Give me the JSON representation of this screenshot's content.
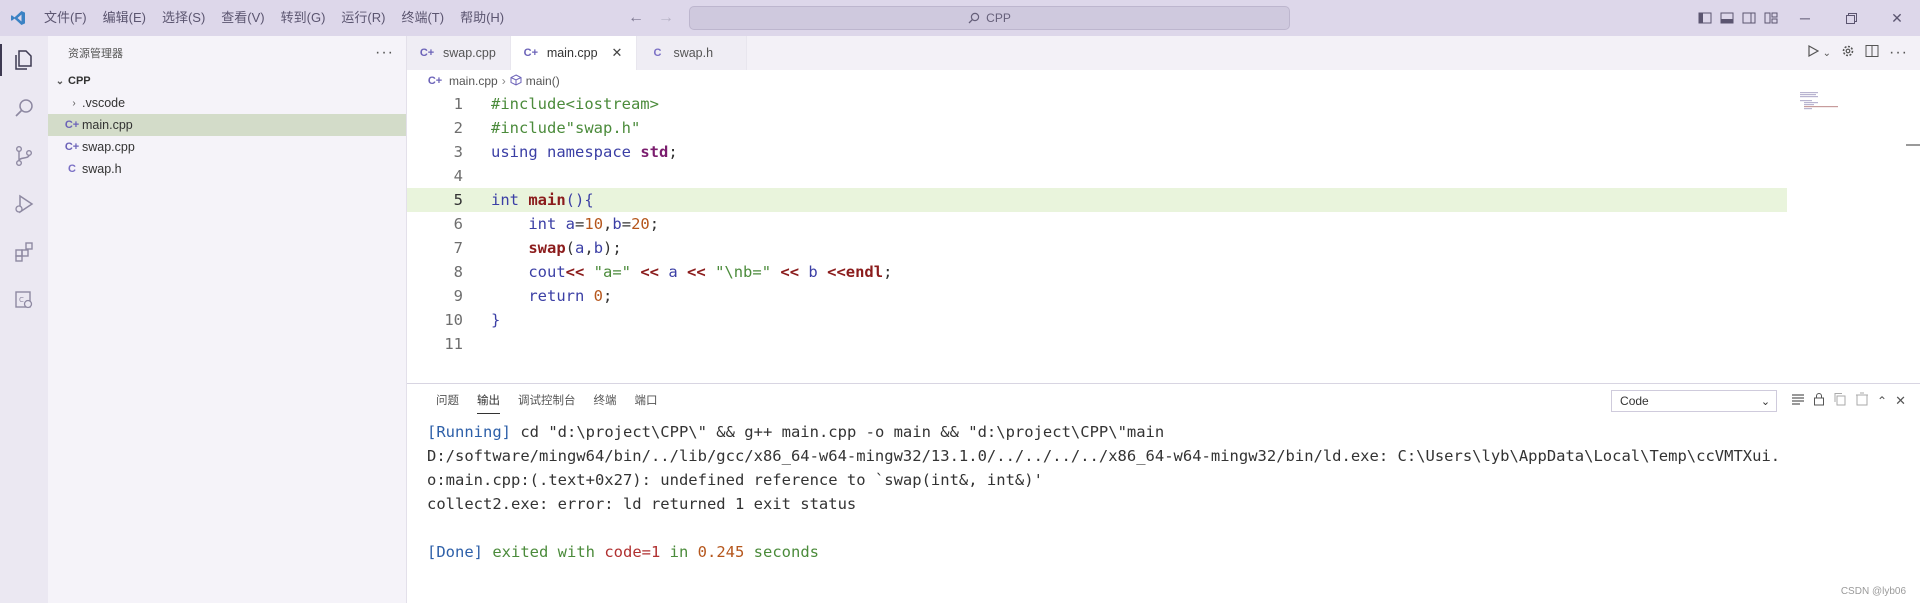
{
  "menu": [
    "文件(F)",
    "编辑(E)",
    "选择(S)",
    "查看(V)",
    "转到(G)",
    "运行(R)",
    "终端(T)",
    "帮助(H)"
  ],
  "search": {
    "text": "CPP"
  },
  "sidebar": {
    "title": "资源管理器",
    "more": "···",
    "root": "CPP",
    "items": [
      {
        "label": ".vscode",
        "type": "folder"
      },
      {
        "label": "main.cpp",
        "type": "cpp",
        "icon": "C+"
      },
      {
        "label": "swap.cpp",
        "type": "cpp",
        "icon": "C+"
      },
      {
        "label": "swap.h",
        "type": "h",
        "icon": "C"
      }
    ]
  },
  "tabs": [
    {
      "label": "swap.cpp",
      "icon": "C+"
    },
    {
      "label": "main.cpp",
      "icon": "C+",
      "active": true
    },
    {
      "label": "swap.h",
      "icon": "C"
    }
  ],
  "breadcrumb": {
    "file": "main.cpp",
    "symbol": "main()"
  },
  "line_numbers": [
    "1",
    "2",
    "3",
    "4",
    "5",
    "6",
    "7",
    "8",
    "9",
    "10",
    "11"
  ],
  "panel": {
    "tabs": [
      "问题",
      "输出",
      "调试控制台",
      "终端",
      "端口"
    ],
    "active_tab": "输出",
    "dropdown": "Code",
    "output": {
      "running_tag": "[Running]",
      "running_cmd": " cd \"d:\\project\\CPP\\\" && g++ main.cpp -o main && \"d:\\project\\CPP\\\"main",
      "line2": "D:/software/mingw64/bin/../lib/gcc/x86_64-w64-mingw32/13.1.0/../../../../x86_64-w64-mingw32/bin/ld.exe: C:\\Users\\lyb\\AppData\\Local\\Temp\\ccVMTXui.",
      "line3": "o:main.cpp:(.text+0x27): undefined reference to `swap(int&, int&)'",
      "line4": "collect2.exe: error: ld returned 1 exit status",
      "done_tag": "[Done]",
      "done_exited": " exited with ",
      "done_code": "code=1",
      "done_in": " in ",
      "done_time": "0.245",
      "done_seconds": " seconds"
    }
  },
  "watermark": "CSDN @lyb06"
}
